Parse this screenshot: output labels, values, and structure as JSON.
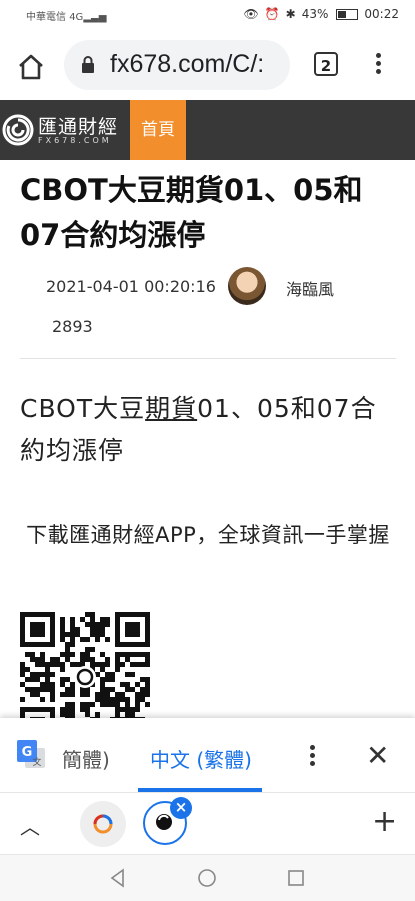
{
  "status_bar": {
    "carrier": "中華電信",
    "network": "4G",
    "battery": "43%",
    "time": "00:22"
  },
  "browser": {
    "url": "fx678.com/C/:",
    "tab_count": "2",
    "icons": [
      "home-icon",
      "lock-icon",
      "tab-switcher-icon",
      "more-vert-icon"
    ]
  },
  "site_header": {
    "logo_text": "匯通財經",
    "logo_sub": "FX678.COM",
    "nav_home": "首頁"
  },
  "article": {
    "title": "CBOT大豆期貨01、05和07合約均漲停",
    "date": "2021-04-01 00:20:16",
    "author": "海臨風",
    "views": "2893",
    "body_before": "CBOT大豆",
    "body_link": "期貨",
    "body_after": "01、05和07合約均漲停",
    "download_text": "下載匯通財經APP，全球資訊一手掌握"
  },
  "translate": {
    "source_lang": "簡體)",
    "target_lang": "中文 (繁體)"
  },
  "colors": {
    "header_bg": "#383838",
    "nav_accent": "#f28e2b",
    "chrome_blue": "#1a73e8"
  }
}
